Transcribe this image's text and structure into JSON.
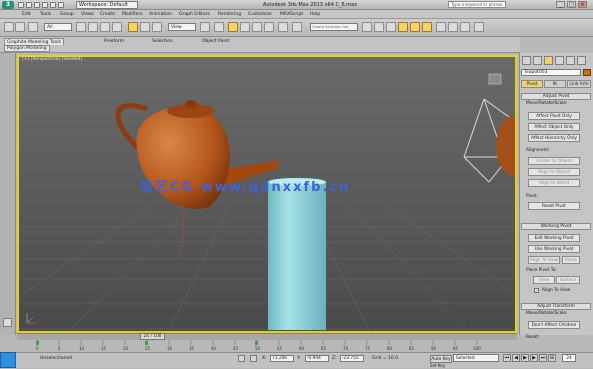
{
  "window": {
    "title": "Autodesk 3ds Max  2013 x64     C_6.max",
    "workspace": "Workspace: Default",
    "help_search_placeholder": "Type a keyword or phrase",
    "app_logo": "3",
    "min_label": "_",
    "max_label": "□",
    "close_label": "×"
  },
  "menu": [
    "Edit",
    "Tools",
    "Group",
    "Views",
    "Create",
    "Modifiers",
    "Animation",
    "Graph Editors",
    "Rendering",
    "Customize",
    "MAXScript",
    "Help"
  ],
  "toolbar": {
    "selection_filter": "All",
    "reference_coord": "View",
    "named_selection_placeholder": "Create Selection Set"
  },
  "ribbon": {
    "tabs": [
      "Graphite Modeling Tools",
      "Freeform",
      "Selection",
      "Object Paint"
    ],
    "active_tab": "Graphite Modeling Tools",
    "panel_label": "Polygon Modeling"
  },
  "viewport": {
    "label": "[+] [Perspective] [Shaded]",
    "watermark": "培艺CG  www.qdnxxfb.cn",
    "teapot_color": "#b5561b",
    "cylinder_color": "#8fd4dc",
    "border_color": "#e7d20f"
  },
  "command_panel": {
    "object_name": "Teapot003",
    "object_color": "#c86a19",
    "tabs": [
      "Pivot",
      "IK",
      "Link Info"
    ],
    "active_tab": "Pivot",
    "adjust_pivot": {
      "header": "Adjust Pivot",
      "group_label": "Move/Rotate/Scale:",
      "buttons": [
        "Affect Pivot Only",
        "Affect Object Only",
        "Affect Hierarchy Only"
      ],
      "alignment_label": "Alignment:",
      "alignment_buttons": [
        "Center to Object",
        "Align to Object",
        "Align to World"
      ],
      "pivot_label": "Pivot:",
      "reset_button": "Reset Pivot"
    },
    "working_pivot": {
      "header": "Working Pivot",
      "buttons": [
        "Edit Working Pivot",
        "Use Working Pivot"
      ],
      "align_view": "Align To View",
      "reset": "Reset",
      "place_pivot_label": "Place Pivot To:",
      "view_btn": "View",
      "surface_btn": "Surface",
      "align_to_view_label": "Align To View",
      "align_to_view_checked": true
    },
    "adjust_transform": {
      "header": "Adjust Transform",
      "group_label": "Move/Rotate/Scale:",
      "dont_affect": "Don't Affect Children",
      "reset_label": "Reset:"
    }
  },
  "timeline": {
    "frame_display": "24 / 100",
    "ticks": [
      "0",
      "5",
      "10",
      "15",
      "20",
      "25",
      "30",
      "35",
      "40",
      "45",
      "50",
      "55",
      "60",
      "65",
      "70",
      "75",
      "80",
      "85",
      "90",
      "95",
      "100"
    ]
  },
  "status": {
    "selection": "Unselectioned",
    "x_label": "X:",
    "x": "71.206",
    "y_label": "Y:",
    "y": "-0.944",
    "z_label": "Z:",
    "z": "-23.755",
    "grid": "Grid = 10.0",
    "auto_key": "Auto Key",
    "set_key_filter": "Selected",
    "set_key_label": "Set Key",
    "frame": "24"
  }
}
